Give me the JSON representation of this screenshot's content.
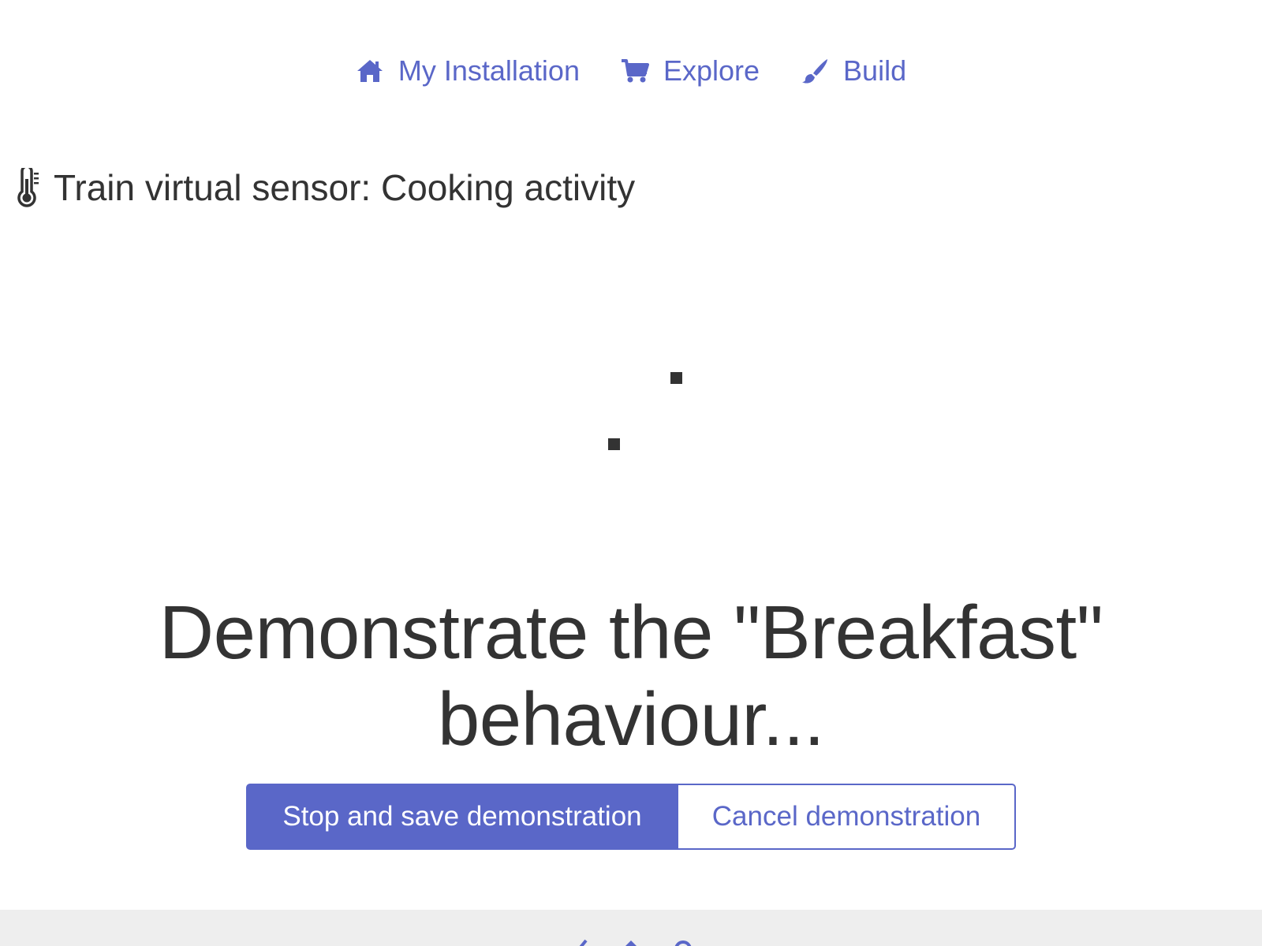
{
  "colors": {
    "accent": "#5a67c8",
    "text": "#333333",
    "footer_bg": "#eeeeee",
    "background": "#ffffff"
  },
  "nav": {
    "items": [
      {
        "label": "My Installation",
        "icon": "home-icon"
      },
      {
        "label": "Explore",
        "icon": "shopping-cart-icon"
      },
      {
        "label": "Build",
        "icon": "paint-brush-icon"
      }
    ]
  },
  "heading": {
    "icon": "thermometer-icon",
    "text": "Train virtual sensor: Cooking activity"
  },
  "spinner": {
    "icon": "loading-spinner-icon"
  },
  "prompt": {
    "line1": "Demonstrate the \"Breakfast\"",
    "line2": "behaviour..."
  },
  "actions": {
    "primary_label": "Stop and save demonstration",
    "secondary_label": "Cancel demonstration"
  },
  "footer": {
    "links": [
      {
        "icon": "footer-link-icon-1"
      },
      {
        "icon": "footer-link-icon-2"
      },
      {
        "icon": "footer-link-icon-3"
      }
    ]
  }
}
